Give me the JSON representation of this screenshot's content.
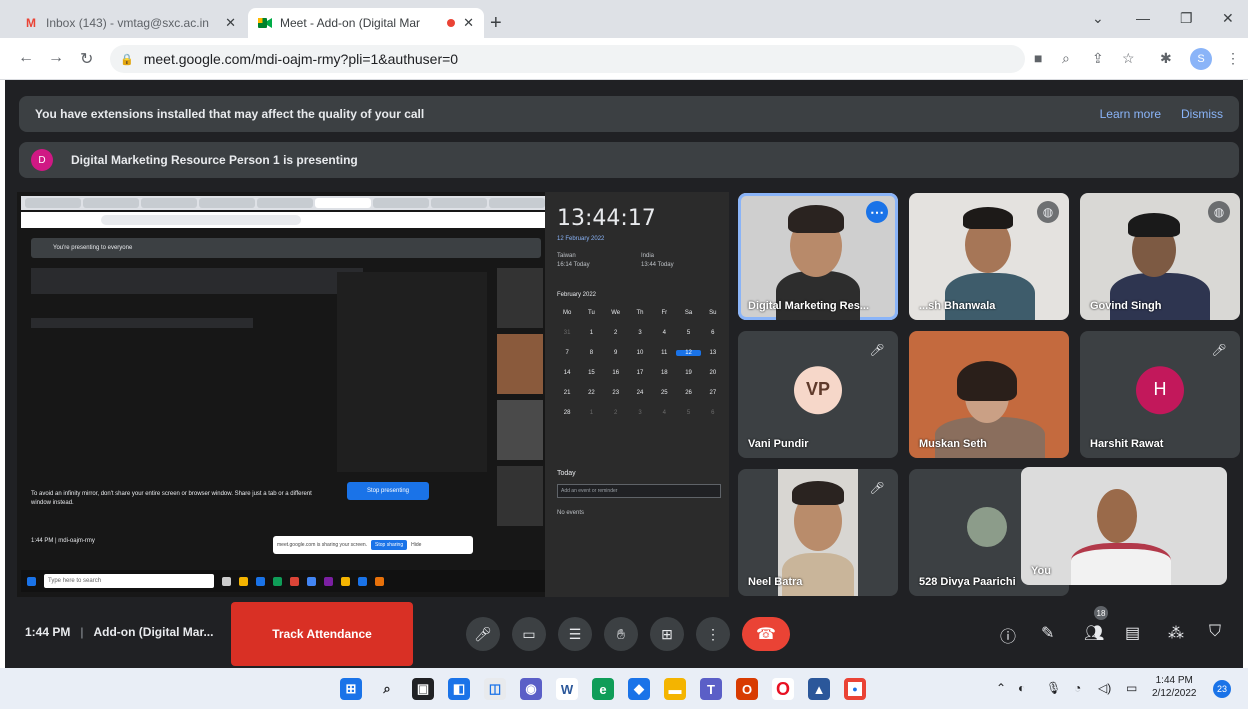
{
  "browser": {
    "tabs": [
      {
        "title": "Inbox (143) - vmtag@sxc.ac.in",
        "icon": "gmail-icon"
      },
      {
        "title": "Meet - Add-on (Digital Mar",
        "icon": "meet-icon"
      }
    ],
    "url": "meet.google.com/mdi-oajm-rmy?pli=1&authuser=0"
  },
  "meet": {
    "banner_text": "You have extensions installed that may affect the quality of your call",
    "learn_more": "Learn more",
    "dismiss": "Dismiss",
    "presenter_initial": "D",
    "presenting_text": "Digital Marketing Resource Person 1 is presenting",
    "shared_screen": {
      "presenting_msg": "You're presenting to everyone",
      "clock_time": "13:44:17",
      "clock_date": "12 February 2022",
      "zone1": [
        "Taiwan",
        "16:14 Today"
      ],
      "zone2": [
        "India",
        "13:44 Today"
      ],
      "calendar_month": "February 2022",
      "weekdays": [
        "Mo",
        "Tu",
        "We",
        "Th",
        "Fr",
        "Sa",
        "Su"
      ],
      "days": [
        "31",
        "1",
        "2",
        "3",
        "4",
        "5",
        "6",
        "7",
        "8",
        "9",
        "10",
        "11",
        "12",
        "13",
        "14",
        "15",
        "16",
        "17",
        "18",
        "19",
        "20",
        "21",
        "22",
        "23",
        "24",
        "25",
        "26",
        "27",
        "28",
        "1",
        "2",
        "3",
        "4",
        "5",
        "6"
      ],
      "today_label": "Today",
      "add_event_placeholder": "Add an event or reminder",
      "no_events": "No events",
      "stop_presenting": "Stop presenting",
      "warning": "To avoid an infinity mirror, don't share your entire screen or browser window. Share just a tab or a different window instead.",
      "footer": "1:44 PM  |  mdi-oajm-rmy",
      "share_notice": "meet.google.com is sharing your screen.",
      "stop_sharing": "Stop sharing",
      "hide": "Hide",
      "taskbar_search": "Type here to search"
    },
    "participants": [
      {
        "name": "Digital Marketing Res...",
        "type": "video"
      },
      {
        "name": "...sh Bhanwala",
        "type": "video"
      },
      {
        "name": "Govind Singh",
        "type": "video"
      },
      {
        "name": "Vani Pundir",
        "type": "avatar",
        "initials": "VP"
      },
      {
        "name": "Muskan Seth",
        "type": "video"
      },
      {
        "name": "Harshit Rawat",
        "type": "avatar",
        "initials": "H"
      },
      {
        "name": "Neel Batra",
        "type": "video"
      },
      {
        "name": "528 Divya Paarichi",
        "type": "video"
      },
      {
        "name": "You",
        "type": "video"
      }
    ],
    "controls": {
      "time": "1:44 PM",
      "meeting_title": "Add-on (Digital Mar...",
      "track_attendance": "Track Attendance",
      "people_count": "18"
    }
  },
  "os": {
    "time": "1:44 PM",
    "date": "2/12/2022",
    "notifications": "23"
  }
}
